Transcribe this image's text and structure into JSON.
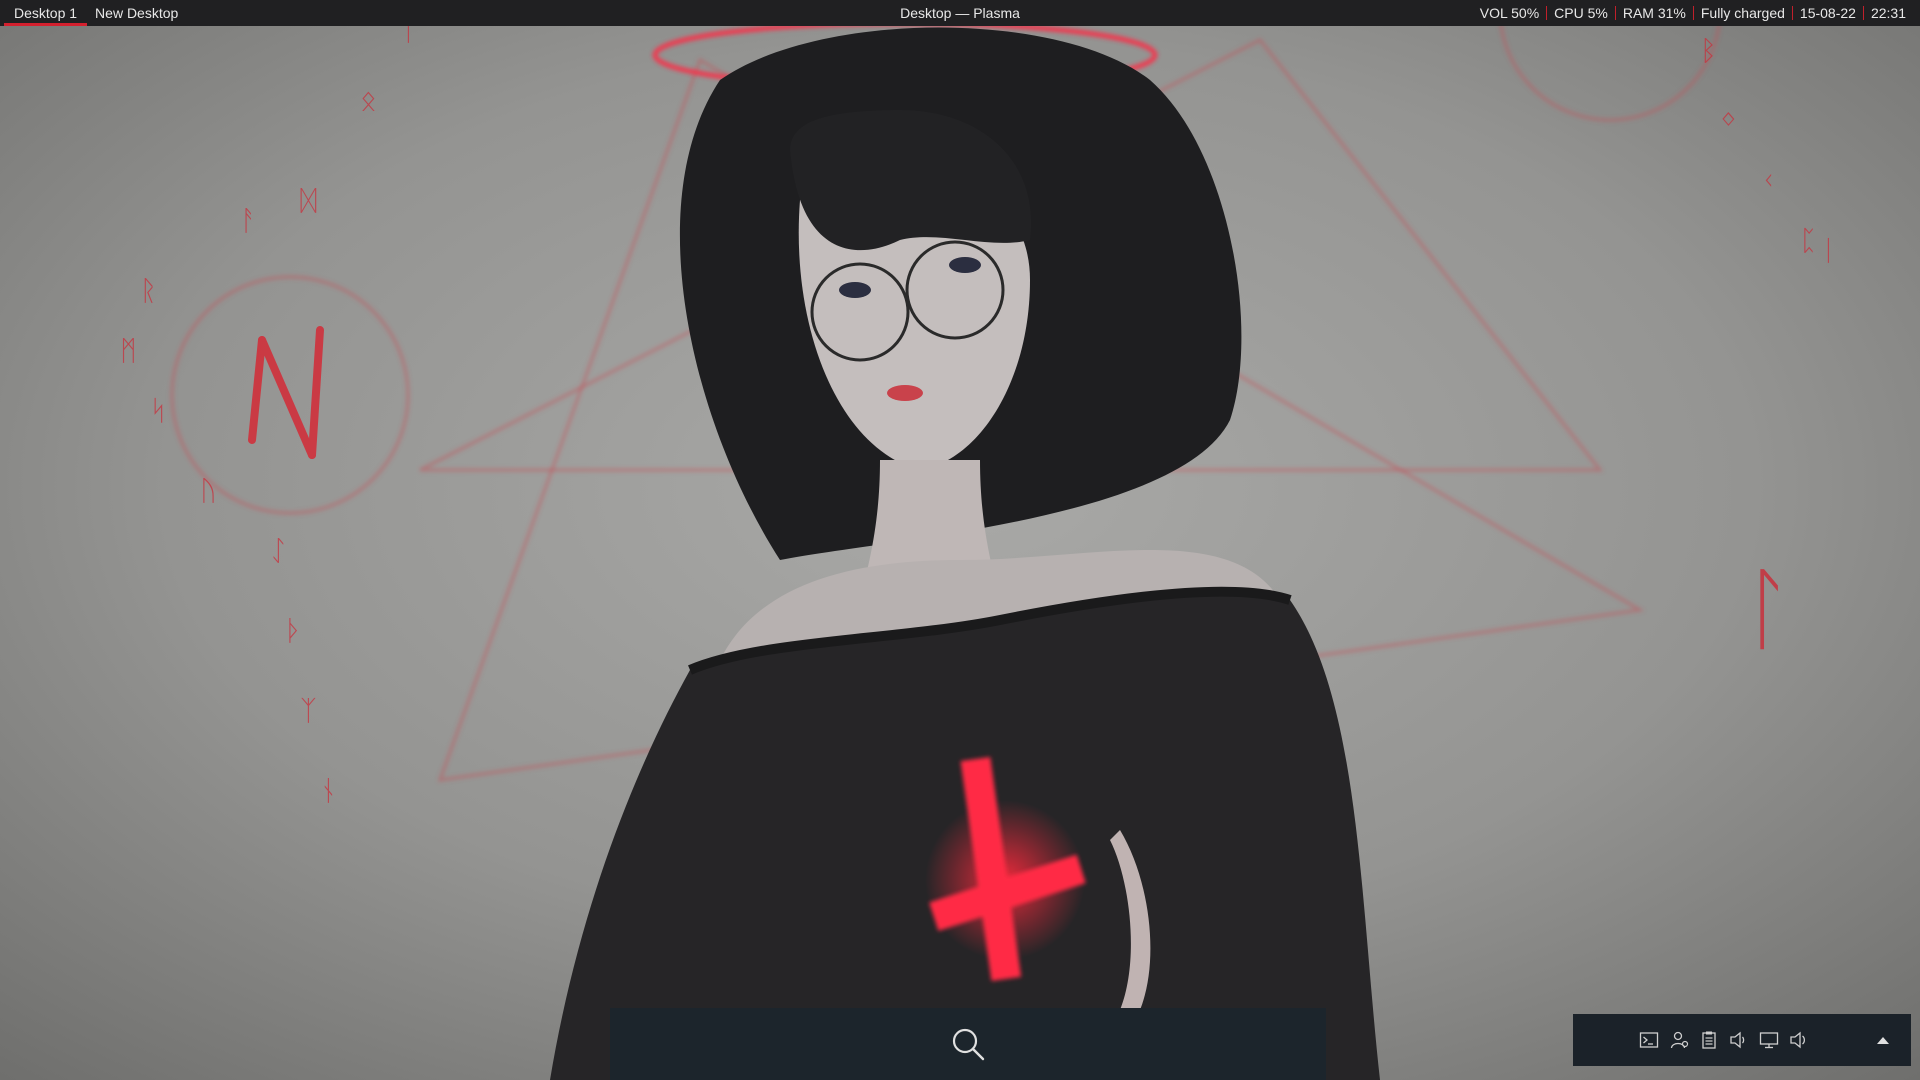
{
  "panel": {
    "desktops": [
      {
        "label": "Desktop 1",
        "active": true
      },
      {
        "label": "New Desktop",
        "active": false
      }
    ],
    "window_title": "Desktop — Plasma",
    "status": {
      "volume": "VOL 50%",
      "cpu": "CPU  5%",
      "ram": "RAM 31%",
      "battery": "Fully charged",
      "date": "15-08-22",
      "time": "22:31"
    }
  },
  "launcher": {
    "icon": "search-icon"
  },
  "tray": {
    "icons": [
      "terminal-icon",
      "user-switch-icon",
      "clipboard-icon",
      "volume-icon",
      "display-icon",
      "speaker-icon"
    ],
    "expand_icon": "chevron-up-icon"
  },
  "colors": {
    "panel_bg": "#202022",
    "accent_red": "#d4202e",
    "launcher_bg": "#1c252c",
    "tray_bg": "#1b2229"
  }
}
